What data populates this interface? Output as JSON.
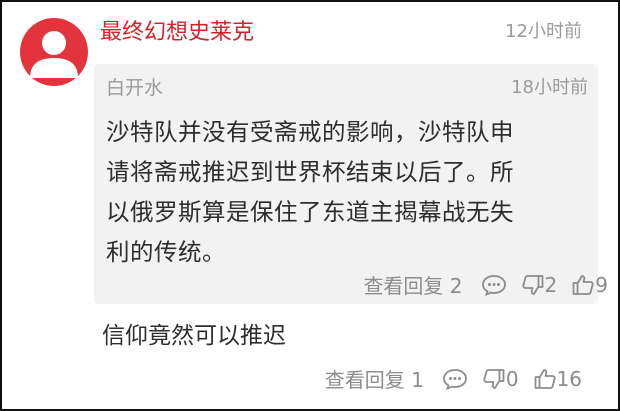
{
  "comment": {
    "author": "最终幻想史莱克",
    "time": "12小时前",
    "quoted": {
      "author": "白开水",
      "time": "18小时前",
      "lines": [
        "沙特队并没有受斋戒的影响，沙特队申",
        "请将斋戒推迟到世界杯结束以后了。所",
        "以俄罗斯算是保住了东道主揭幕战无失",
        "利的传统。"
      ],
      "actions": {
        "replies_label": "查看回复 2",
        "dislikes": "2",
        "likes": "9"
      }
    },
    "text": "信仰竟然可以推迟",
    "actions": {
      "replies_label": "查看回复 1",
      "dislikes": "0",
      "likes": "16"
    }
  },
  "colors": {
    "author": "#d3222a",
    "avatar": "#e3343e",
    "muted": "#9a9a9a",
    "quote_bg": "#f2f2f2"
  }
}
